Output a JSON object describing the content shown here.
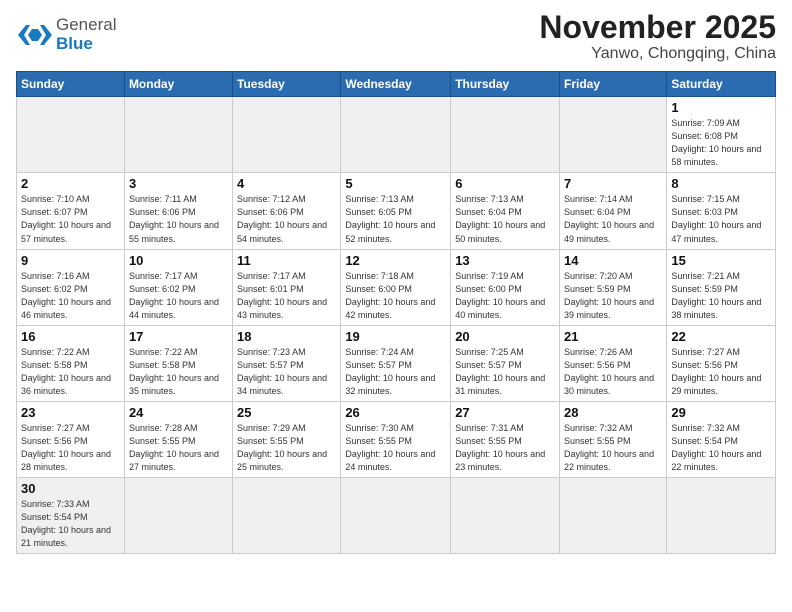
{
  "header": {
    "logo_general": "General",
    "logo_blue": "Blue",
    "title": "November 2025",
    "subtitle": "Yanwo, Chongqing, China"
  },
  "days_of_week": [
    "Sunday",
    "Monday",
    "Tuesday",
    "Wednesday",
    "Thursday",
    "Friday",
    "Saturday"
  ],
  "weeks": [
    [
      {
        "day": "",
        "empty": true
      },
      {
        "day": "",
        "empty": true
      },
      {
        "day": "",
        "empty": true
      },
      {
        "day": "",
        "empty": true
      },
      {
        "day": "",
        "empty": true
      },
      {
        "day": "",
        "empty": true
      },
      {
        "day": "1",
        "sunrise": "7:09 AM",
        "sunset": "6:08 PM",
        "daylight": "10 hours and 58 minutes."
      }
    ],
    [
      {
        "day": "2",
        "sunrise": "7:10 AM",
        "sunset": "6:07 PM",
        "daylight": "10 hours and 57 minutes."
      },
      {
        "day": "3",
        "sunrise": "7:11 AM",
        "sunset": "6:06 PM",
        "daylight": "10 hours and 55 minutes."
      },
      {
        "day": "4",
        "sunrise": "7:12 AM",
        "sunset": "6:06 PM",
        "daylight": "10 hours and 54 minutes."
      },
      {
        "day": "5",
        "sunrise": "7:13 AM",
        "sunset": "6:05 PM",
        "daylight": "10 hours and 52 minutes."
      },
      {
        "day": "6",
        "sunrise": "7:13 AM",
        "sunset": "6:04 PM",
        "daylight": "10 hours and 50 minutes."
      },
      {
        "day": "7",
        "sunrise": "7:14 AM",
        "sunset": "6:04 PM",
        "daylight": "10 hours and 49 minutes."
      },
      {
        "day": "8",
        "sunrise": "7:15 AM",
        "sunset": "6:03 PM",
        "daylight": "10 hours and 47 minutes."
      }
    ],
    [
      {
        "day": "9",
        "sunrise": "7:16 AM",
        "sunset": "6:02 PM",
        "daylight": "10 hours and 46 minutes."
      },
      {
        "day": "10",
        "sunrise": "7:17 AM",
        "sunset": "6:02 PM",
        "daylight": "10 hours and 44 minutes."
      },
      {
        "day": "11",
        "sunrise": "7:17 AM",
        "sunset": "6:01 PM",
        "daylight": "10 hours and 43 minutes."
      },
      {
        "day": "12",
        "sunrise": "7:18 AM",
        "sunset": "6:00 PM",
        "daylight": "10 hours and 42 minutes."
      },
      {
        "day": "13",
        "sunrise": "7:19 AM",
        "sunset": "6:00 PM",
        "daylight": "10 hours and 40 minutes."
      },
      {
        "day": "14",
        "sunrise": "7:20 AM",
        "sunset": "5:59 PM",
        "daylight": "10 hours and 39 minutes."
      },
      {
        "day": "15",
        "sunrise": "7:21 AM",
        "sunset": "5:59 PM",
        "daylight": "10 hours and 38 minutes."
      }
    ],
    [
      {
        "day": "16",
        "sunrise": "7:22 AM",
        "sunset": "5:58 PM",
        "daylight": "10 hours and 36 minutes."
      },
      {
        "day": "17",
        "sunrise": "7:22 AM",
        "sunset": "5:58 PM",
        "daylight": "10 hours and 35 minutes."
      },
      {
        "day": "18",
        "sunrise": "7:23 AM",
        "sunset": "5:57 PM",
        "daylight": "10 hours and 34 minutes."
      },
      {
        "day": "19",
        "sunrise": "7:24 AM",
        "sunset": "5:57 PM",
        "daylight": "10 hours and 32 minutes."
      },
      {
        "day": "20",
        "sunrise": "7:25 AM",
        "sunset": "5:57 PM",
        "daylight": "10 hours and 31 minutes."
      },
      {
        "day": "21",
        "sunrise": "7:26 AM",
        "sunset": "5:56 PM",
        "daylight": "10 hours and 30 minutes."
      },
      {
        "day": "22",
        "sunrise": "7:27 AM",
        "sunset": "5:56 PM",
        "daylight": "10 hours and 29 minutes."
      }
    ],
    [
      {
        "day": "23",
        "sunrise": "7:27 AM",
        "sunset": "5:56 PM",
        "daylight": "10 hours and 28 minutes."
      },
      {
        "day": "24",
        "sunrise": "7:28 AM",
        "sunset": "5:55 PM",
        "daylight": "10 hours and 27 minutes."
      },
      {
        "day": "25",
        "sunrise": "7:29 AM",
        "sunset": "5:55 PM",
        "daylight": "10 hours and 25 minutes."
      },
      {
        "day": "26",
        "sunrise": "7:30 AM",
        "sunset": "5:55 PM",
        "daylight": "10 hours and 24 minutes."
      },
      {
        "day": "27",
        "sunrise": "7:31 AM",
        "sunset": "5:55 PM",
        "daylight": "10 hours and 23 minutes."
      },
      {
        "day": "28",
        "sunrise": "7:32 AM",
        "sunset": "5:55 PM",
        "daylight": "10 hours and 22 minutes."
      },
      {
        "day": "29",
        "sunrise": "7:32 AM",
        "sunset": "5:54 PM",
        "daylight": "10 hours and 22 minutes."
      }
    ],
    [
      {
        "day": "30",
        "sunrise": "7:33 AM",
        "sunset": "5:54 PM",
        "daylight": "10 hours and 21 minutes."
      },
      {
        "day": "",
        "empty": true
      },
      {
        "day": "",
        "empty": true
      },
      {
        "day": "",
        "empty": true
      },
      {
        "day": "",
        "empty": true
      },
      {
        "day": "",
        "empty": true
      },
      {
        "day": "",
        "empty": true
      }
    ]
  ]
}
